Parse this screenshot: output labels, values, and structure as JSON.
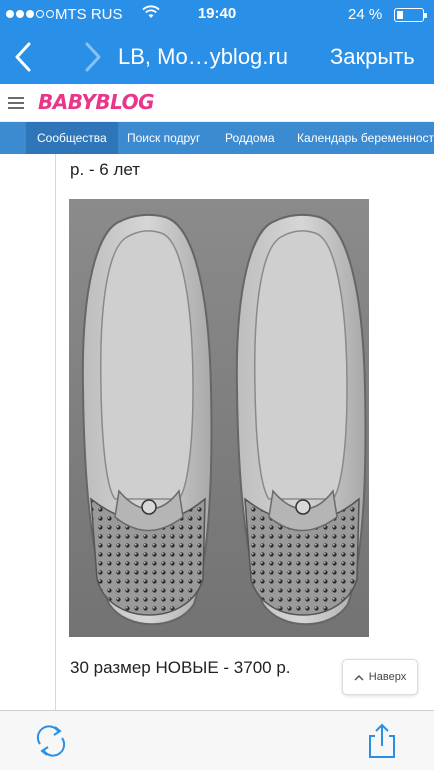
{
  "status_bar": {
    "carrier": "MTS RUS",
    "time": "19:40",
    "battery_percent": "24 %",
    "battery_level": 0.24,
    "signal_dots_filled": 3
  },
  "browser": {
    "title": "LB, Mo…yblog.ru",
    "close_label": "Закрыть",
    "back_icon": "chevron-left-icon",
    "forward_icon": "chevron-right-icon"
  },
  "site": {
    "logo": "BABYBLOG",
    "nav": [
      "Сообщества",
      "Поиск подруг",
      "Роддома",
      "Календарь беременности"
    ],
    "active_nav": 0
  },
  "post": {
    "text_top": "р. - 6 лет",
    "text_bottom": "30 размер НОВЫЕ - 3700 р.",
    "image_alt": "shoes-photo"
  },
  "scroll_top_button": {
    "label": "Наверх"
  },
  "toolbar": {
    "refresh_icon": "refresh-icon",
    "share_icon": "share-icon"
  },
  "colors": {
    "browser_blue": "#2a8fe6",
    "nav_blue": "#3c8ad0",
    "logo_pink": "#e8368a"
  }
}
